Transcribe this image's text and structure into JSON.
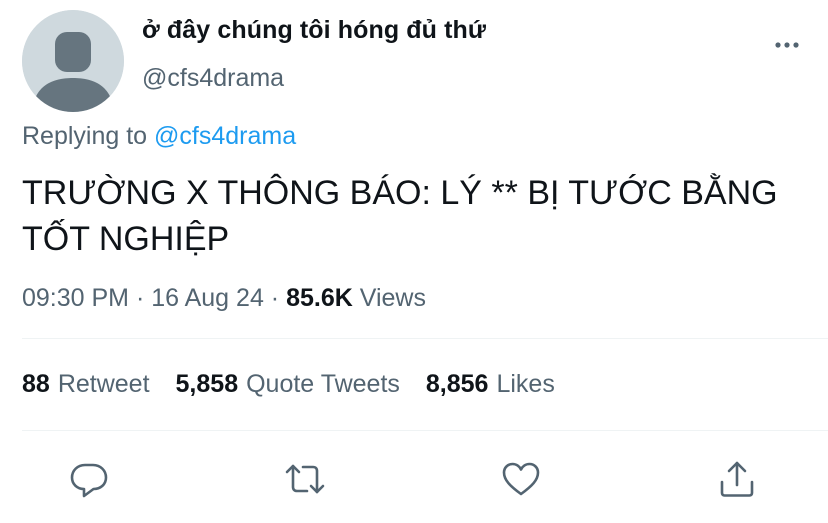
{
  "author": {
    "display_name": "ở đây chúng tôi hóng đủ thứ",
    "handle": "@cfs4drama",
    "avatar_icon": "default-avatar-icon"
  },
  "reply": {
    "prefix": "Replying to ",
    "mention": "@cfs4drama"
  },
  "tweet": {
    "text": "TRƯỜNG X THÔNG BÁO: LÝ ** BỊ TƯỚC BẰNG TỐT NGHIỆP"
  },
  "meta": {
    "time": "09:30 PM",
    "separator": " · ",
    "date": "16 Aug 24",
    "views_count": "85.6K",
    "views_label": " Views"
  },
  "stats": {
    "retweets": {
      "count": "88",
      "label": "Retweet"
    },
    "quotes": {
      "count": "5,858",
      "label": "Quote Tweets"
    },
    "likes": {
      "count": "8,856",
      "label": "Likes"
    }
  },
  "actions": {
    "reply_icon": "reply-icon",
    "retweet_icon": "retweet-icon",
    "like_icon": "like-icon",
    "share_icon": "share-icon",
    "more_icon": "more-icon"
  },
  "colors": {
    "text": "#0f1419",
    "secondary": "#536471",
    "link": "#1d9bf0",
    "divider": "#eff3f4",
    "avatar_bg": "#cfd9de"
  }
}
